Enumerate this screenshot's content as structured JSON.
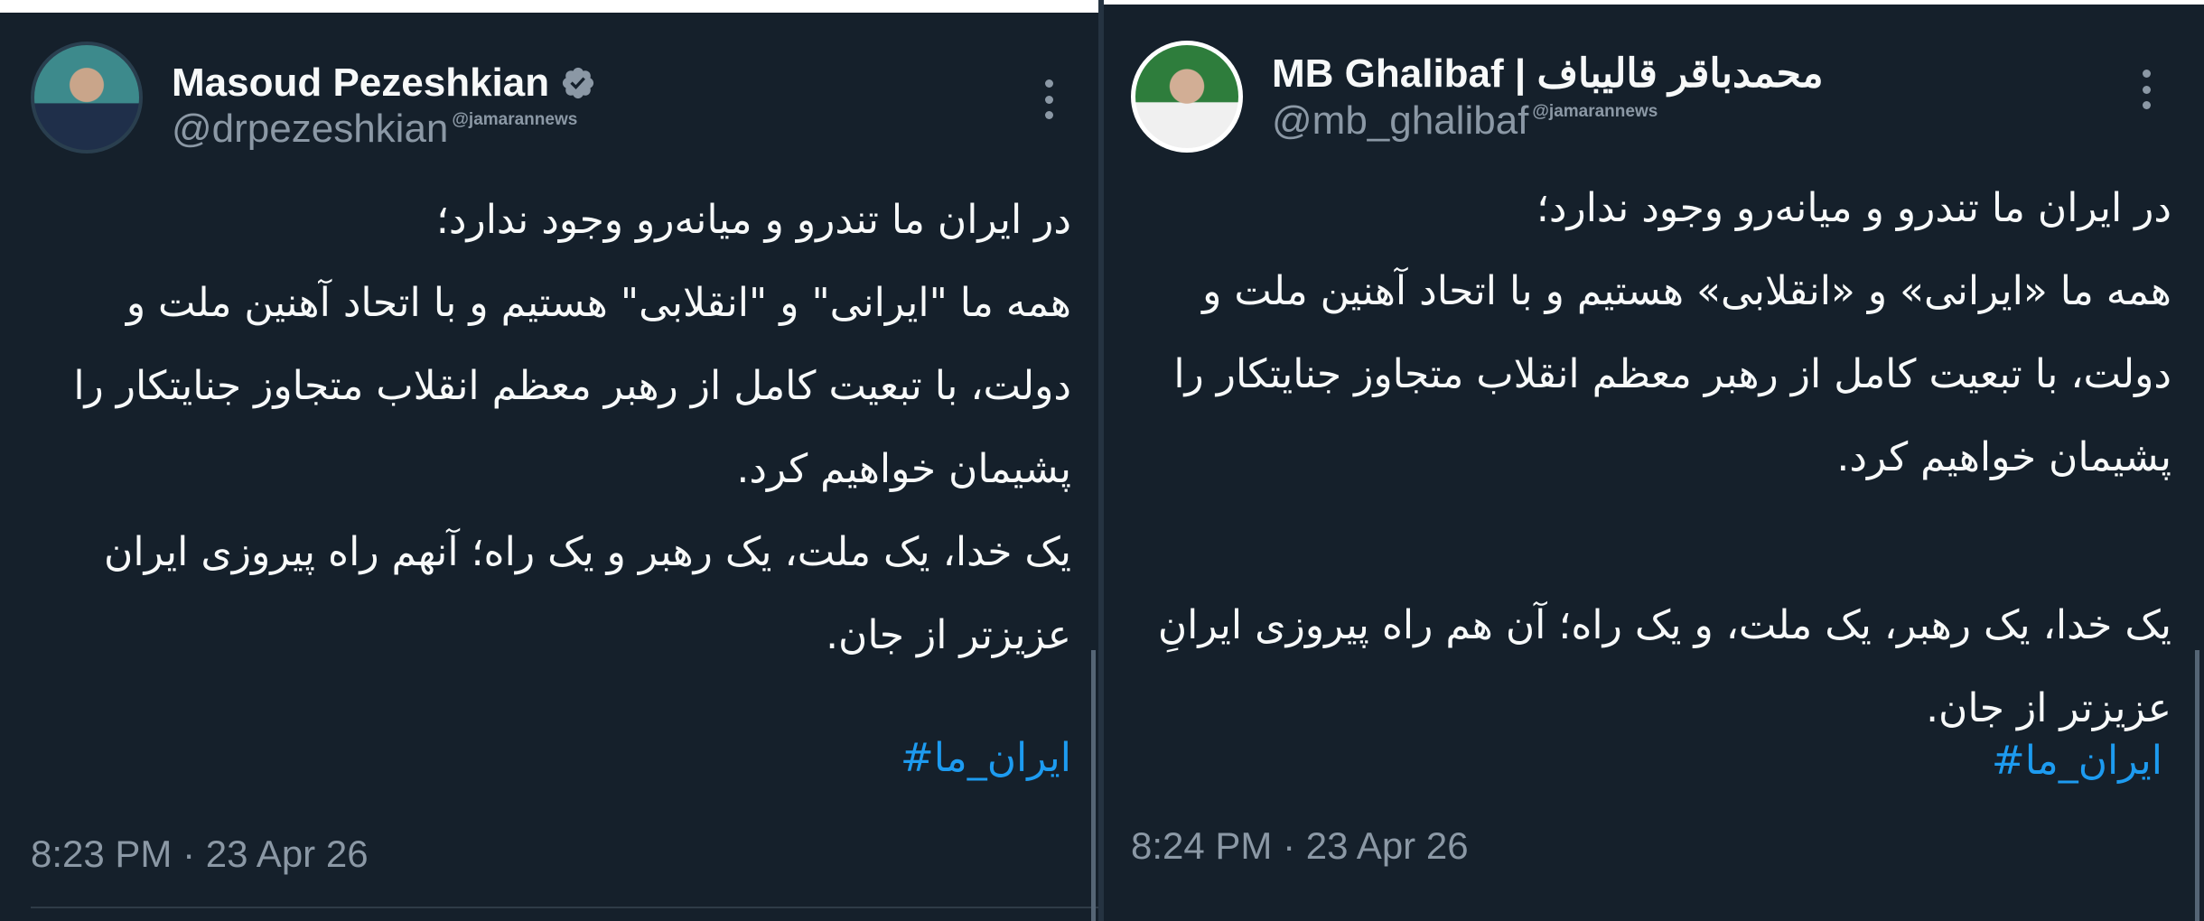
{
  "left": {
    "display_name": "Masoud Pezeshkian",
    "handle": "@drpezeshkian",
    "watermark": "@jamarannews",
    "tweet_lines": [
      "در ایران ما تندرو و میانه‌رو وجود ندارد؛",
      "همه ما \"ایرانی\" و \"انقلابی\" هستیم و با اتحاد آهنین ملت و",
      "دولت، با تبعیت کامل از رهبر معظم انقلاب متجاوز جنایتکار را",
      "پشیمان خواهیم کرد.",
      "یک خدا، یک ملت، یک رهبر و یک راه؛ آنهم راه پیروزی ایران",
      "عزیزتر از جان."
    ],
    "hashtag": "#ایران_ما",
    "timestamp": "8:23 PM · 23 Apr 26"
  },
  "right": {
    "display_name": "MB Ghalibaf | محمدباقر قالیباف",
    "handle": "@mb_ghalibaf",
    "watermark": "@jamarannews",
    "tweet_lines": [
      "در ایران ما تندرو و میانه‌رو وجود ندارد؛",
      "همه ما «ایرانی» و «انقلابی» هستیم و با اتحاد آهنین ملت و",
      "دولت، با تبعیت کامل از رهبر معظم انقلاب متجاوز جنایتکار را",
      "پشیمان خواهیم کرد."
    ],
    "tweet_lines_2": [
      "یک خدا، یک رهبر، یک ملت، و یک راه؛ آن هم راه پیروزی ایرانِ",
      "عزیزتر از جان."
    ],
    "hashtag": "#ایران_ما",
    "timestamp": "8:24 PM · 23 Apr 26"
  },
  "icons": {
    "verified": "verified-badge-icon",
    "more": "more-options-icon"
  },
  "colors": {
    "background": "#15202b",
    "text": "#f7f9f9",
    "secondary": "#8b98a5",
    "link": "#1d9bf0"
  }
}
